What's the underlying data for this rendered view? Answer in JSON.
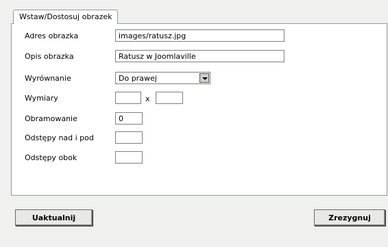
{
  "tab": {
    "label": "Wstaw/Dostosuj obrazek"
  },
  "fields": {
    "image_url": {
      "label": "Adres obrazka",
      "value": "images/ratusz.jpg"
    },
    "image_desc": {
      "label": "Opis obrazka",
      "value": "Ratusz w Joomlaville"
    },
    "alignment": {
      "label": "Wyrównanie",
      "value": "Do prawej"
    },
    "dimensions": {
      "label": "Wymiary",
      "width": "",
      "separator": "x",
      "height": ""
    },
    "border": {
      "label": "Obramowanie",
      "value": "0"
    },
    "vspace": {
      "label": "Odstępy nad i pod",
      "value": ""
    },
    "hspace": {
      "label": "Odstępy obok",
      "value": ""
    }
  },
  "buttons": {
    "update": "Uaktualnij",
    "cancel": "Zrezygnuj"
  }
}
